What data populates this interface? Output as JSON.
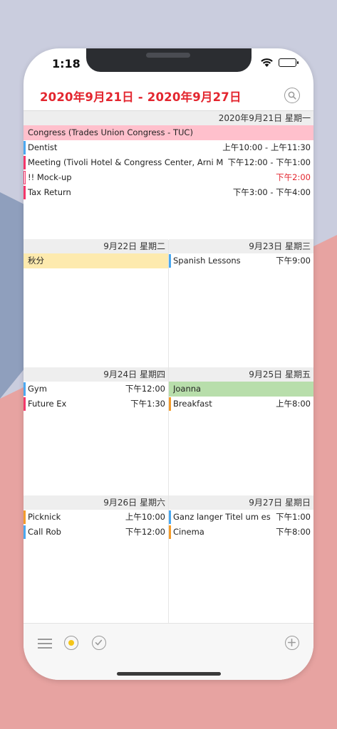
{
  "status": {
    "time": "1:18"
  },
  "header": {
    "title": "2020年9月21日 - 2020年9月27日"
  },
  "colors": {
    "accent_red": "#e3262f",
    "pink": "#f3376a",
    "blue": "#4aa8f0",
    "orange": "#f39c2a",
    "allday_pink": "#ffc0cc",
    "allday_yellow": "#fdeaae",
    "allday_green": "#b8deab"
  },
  "days": [
    {
      "header": "2020年9月21日 星期一",
      "events": [
        {
          "title": "Congress (Trades Union Congress - TUC)",
          "time": "",
          "allday": true,
          "color": "#ffc0cc"
        },
        {
          "title": "Dentist",
          "time": "上午10:00 - 上午11:30",
          "color": "#4aa8f0"
        },
        {
          "title": "Meeting (Tivoli Hotel & Congress Center, Arni Ma...",
          "time": "下午12:00 - 下午1:00",
          "color": "#f3376a"
        },
        {
          "title": "!! Mock-up",
          "time": "下午2:00",
          "color": "#f3376a",
          "time_color": "#e3262f",
          "outlined": true
        },
        {
          "title": "Tax Return",
          "time": "下午3:00 - 下午4:00",
          "color": "#f3376a"
        }
      ]
    },
    {
      "header": "9月22日 星期二",
      "events": [
        {
          "title": "秋分",
          "time": "",
          "allday": true,
          "color": "#fdeaae"
        }
      ]
    },
    {
      "header": "9月23日 星期三",
      "events": [
        {
          "title": "Spanish Lessons",
          "time": "下午9:00",
          "color": "#4aa8f0"
        }
      ]
    },
    {
      "header": "9月24日 星期四",
      "events": [
        {
          "title": "Gym",
          "time": "下午12:00",
          "color": "#4aa8f0"
        },
        {
          "title": "Future Ex",
          "time": "下午1:30",
          "color": "#f3376a"
        }
      ]
    },
    {
      "header": "9月25日 星期五",
      "events": [
        {
          "title": "Joanna",
          "time": "",
          "allday": true,
          "color": "#b8deab"
        },
        {
          "title": "Breakfast",
          "time": "上午8:00",
          "color": "#f39c2a"
        }
      ]
    },
    {
      "header": "9月26日 星期六",
      "events": [
        {
          "title": "Picknick",
          "time": "上午10:00",
          "color": "#f39c2a"
        },
        {
          "title": "Call Rob",
          "time": "下午12:00",
          "color": "#4aa8f0"
        }
      ]
    },
    {
      "header": "9月27日 星期日",
      "events": [
        {
          "title": "Ganz langer Titel um es...",
          "time": "下午1:00",
          "color": "#4aa8f0"
        },
        {
          "title": "Cinema",
          "time": "下午8:00",
          "color": "#f39c2a"
        }
      ]
    }
  ],
  "toolbar": {
    "icons": [
      "menu-icon",
      "today-icon",
      "checkmark-icon",
      "add-icon"
    ]
  }
}
